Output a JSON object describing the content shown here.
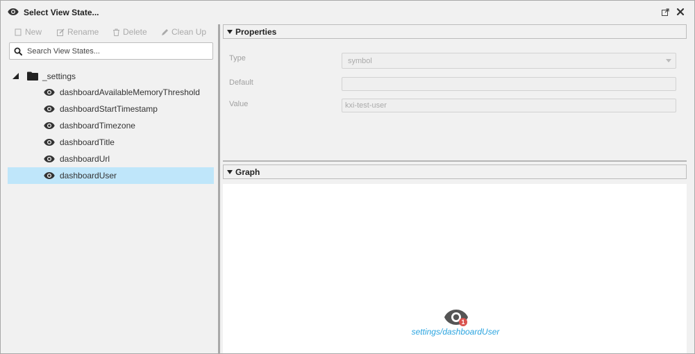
{
  "window": {
    "title": "Select View State..."
  },
  "toolbar": {
    "new_label": "New",
    "rename_label": "Rename",
    "delete_label": "Delete",
    "cleanup_label": "Clean Up"
  },
  "search": {
    "placeholder": "Search View States..."
  },
  "tree": {
    "folder": {
      "label": "_settings",
      "expanded": true
    },
    "items": [
      {
        "label": "dashboardAvailableMemoryThreshold",
        "selected": false
      },
      {
        "label": "dashboardStartTimestamp",
        "selected": false
      },
      {
        "label": "dashboardTimezone",
        "selected": false
      },
      {
        "label": "dashboardTitle",
        "selected": false
      },
      {
        "label": "dashboardUrl",
        "selected": false
      },
      {
        "label": "dashboardUser",
        "selected": true
      }
    ]
  },
  "properties": {
    "header": "Properties",
    "type_label": "Type",
    "type_value": "symbol",
    "default_label": "Default",
    "default_value": "",
    "value_label": "Value",
    "value_value": "kxi-test-user"
  },
  "graph": {
    "header": "Graph",
    "node_label": "settings/dashboardUser",
    "node_badge": "1"
  },
  "colors": {
    "selection": "#bfe6fa",
    "link": "#2aa4e0",
    "badge": "#d9534f"
  },
  "icons": {
    "title": "eye-icon",
    "popout": "external-link-icon",
    "close": "close-icon",
    "folder": "folder-icon",
    "item": "eye-icon",
    "search": "search-icon"
  }
}
